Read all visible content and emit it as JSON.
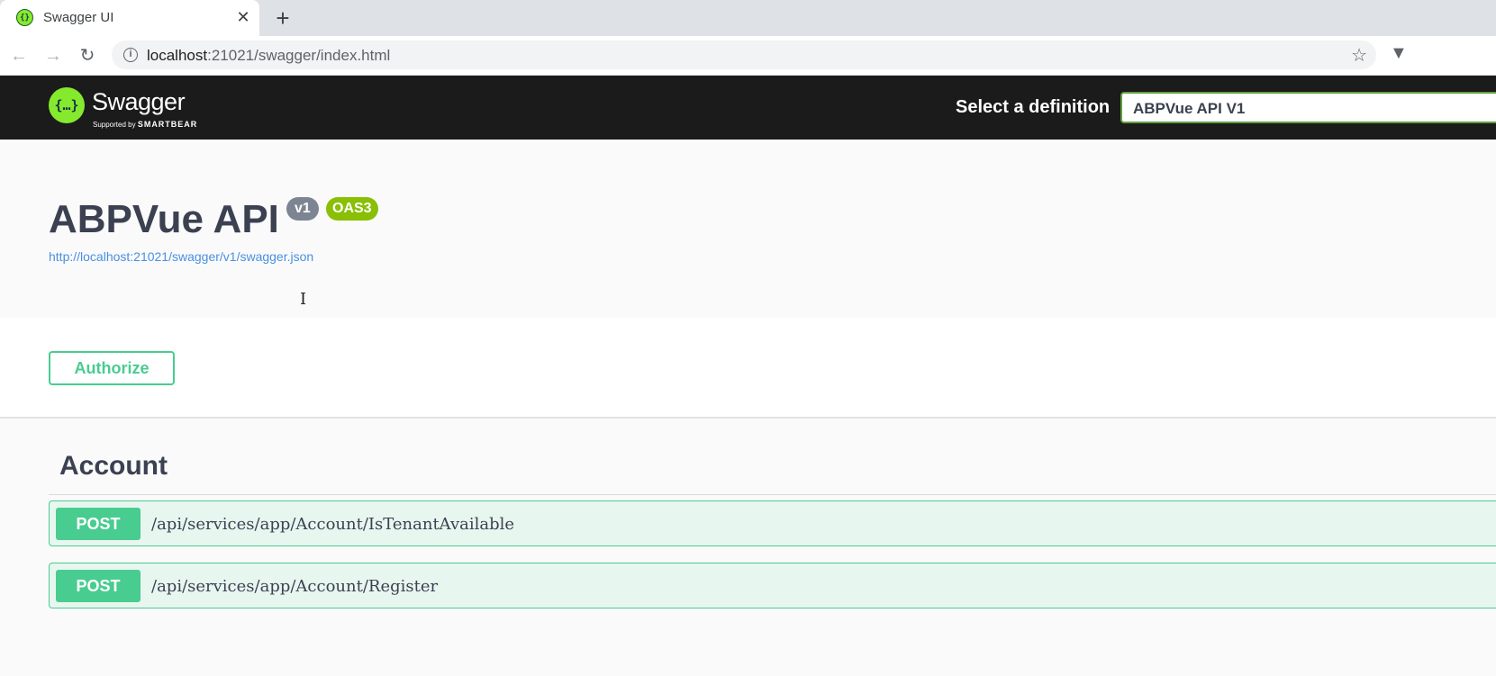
{
  "browser": {
    "tab_title": "Swagger UI",
    "tab_close": "✕",
    "new_tab": "+",
    "url_host": "localhost",
    "url_path": ":21021/swagger/index.html"
  },
  "swagger": {
    "logo_mark": "{…}",
    "logo_name": "Swagger",
    "logo_sub_prefix": "Supported by ",
    "logo_sub_brand": "SMARTBEAR",
    "definition_label": "Select a definition",
    "definition_selected": "ABPVue API V1"
  },
  "info": {
    "title": "ABPVue API",
    "version_badge": "v1",
    "oas_badge": "OAS3",
    "spec_url": "http://localhost:21021/swagger/v1/swagger.json"
  },
  "scheme": {
    "authorize_label": "Authorize"
  },
  "tags": [
    {
      "name": "Account",
      "operations": [
        {
          "method": "POST",
          "path": "/api/services/app/Account/IsTenantAvailable"
        },
        {
          "method": "POST",
          "path": "/api/services/app/Account/Register"
        }
      ]
    }
  ],
  "colors": {
    "post": "#49cc90",
    "post_bg": "#e8f6f0",
    "topbar": "#1b1b1b",
    "accent": "#85ea2d",
    "oas_badge": "#89bf04",
    "version_badge": "#7d8492"
  }
}
